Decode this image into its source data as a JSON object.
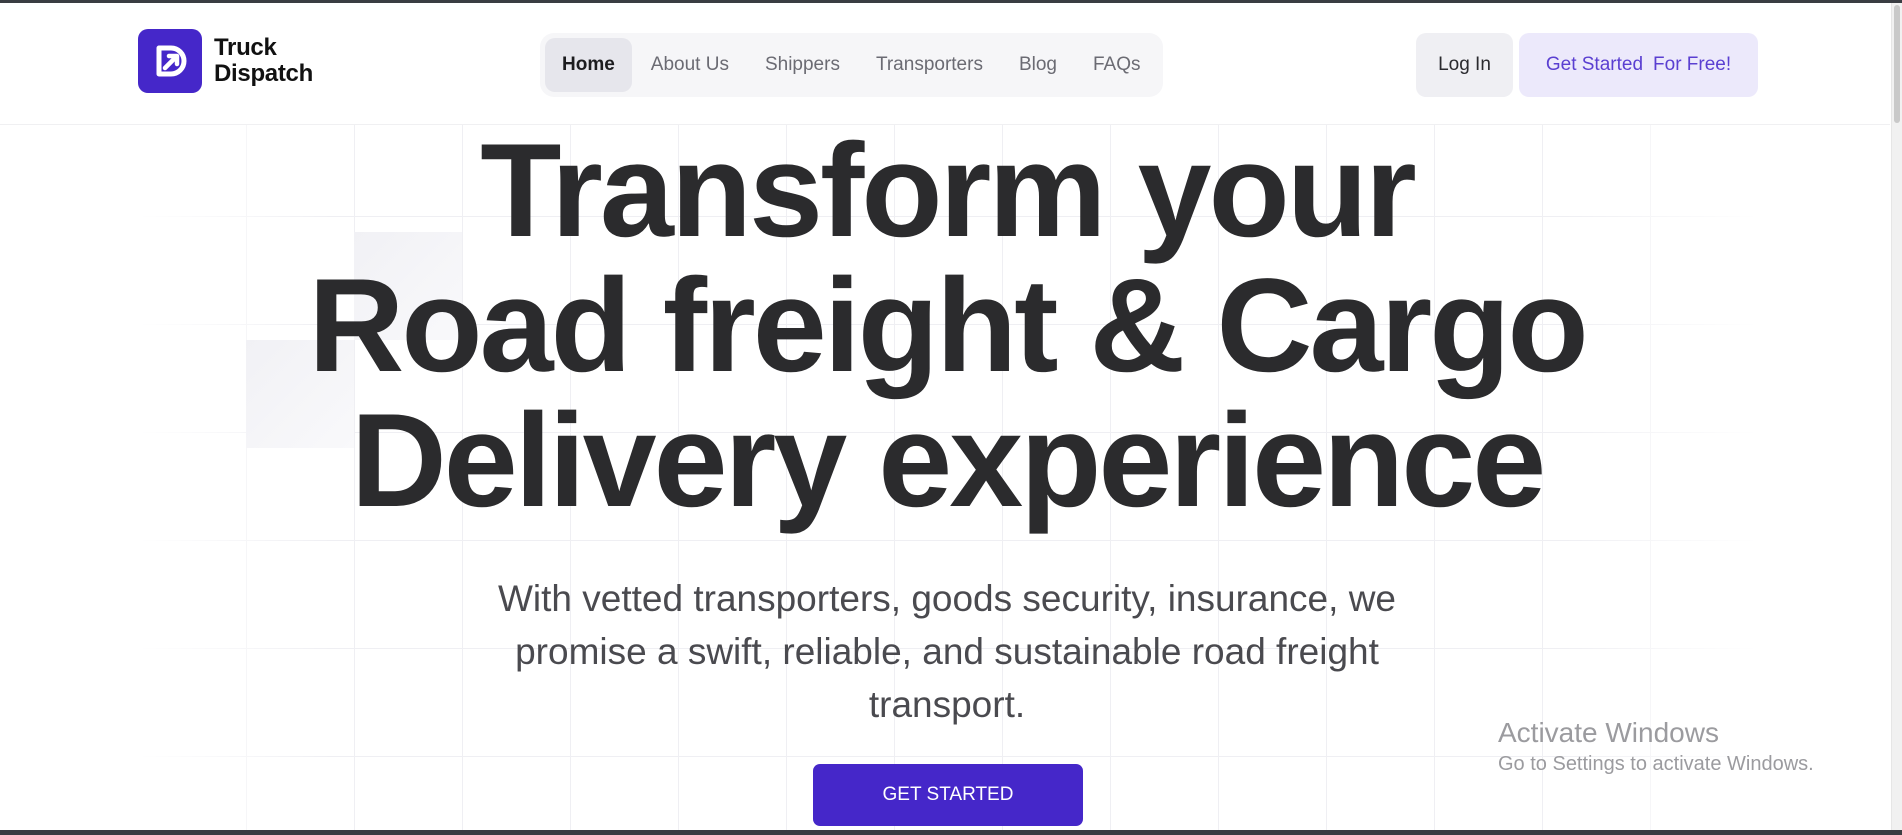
{
  "brand": {
    "name_line1": "Truck",
    "name_line2": "Dispatch",
    "logo_icon": "truck-dispatch-logo-icon",
    "accent_color": "#4527c9"
  },
  "nav": {
    "items": [
      {
        "label": "Home",
        "active": true
      },
      {
        "label": "About Us",
        "active": false
      },
      {
        "label": "Shippers",
        "active": false
      },
      {
        "label": "Transporters",
        "active": false
      },
      {
        "label": "Blog",
        "active": false
      },
      {
        "label": "FAQs",
        "active": false
      }
    ]
  },
  "header_actions": {
    "login_label": "Log In",
    "get_started_label": "Get Started",
    "for_free_label": "For Free!"
  },
  "hero": {
    "title_lines": [
      "Transform your",
      "Road freight & Cargo",
      "Delivery experience"
    ],
    "subtitle_lines": [
      "With vetted transporters, goods security, insurance, we",
      "promise a swift, reliable, and sustainable road freight",
      "transport."
    ],
    "cta_label": "GET STARTED"
  },
  "watermark": {
    "title": "Activate Windows",
    "subtitle": "Go to Settings to activate Windows."
  }
}
